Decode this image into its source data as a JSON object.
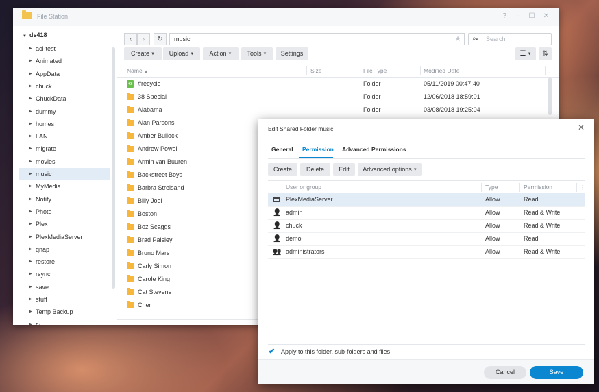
{
  "window": {
    "title": "File Station",
    "controls": [
      "?",
      "–",
      "☐",
      "✕"
    ]
  },
  "tree": {
    "root": "ds418",
    "selected": "music",
    "items": [
      "acl-test",
      "Animated",
      "AppData",
      "chuck",
      "ChuckData",
      "dummy",
      "homes",
      "LAN",
      "migrate",
      "movies",
      "music",
      "MyMedia",
      "Notify",
      "Photo",
      "Plex",
      "PlexMediaServer",
      "qnap",
      "restore",
      "rsync",
      "save",
      "stuff",
      "Temp Backup",
      "tv"
    ]
  },
  "toolbar": {
    "path": "music",
    "search_placeholder": "Search",
    "buttons": [
      "Create",
      "Upload",
      "Action",
      "Tools",
      "Settings"
    ]
  },
  "list": {
    "columns": [
      "Name",
      "Size",
      "File Type",
      "Modified Date"
    ],
    "rows": [
      {
        "name": "#recycle",
        "type": "Folder",
        "date": "05/11/2019 00:47:40",
        "icon": "recycle-icon"
      },
      {
        "name": "38 Special",
        "type": "Folder",
        "date": "12/06/2018 18:59:01",
        "icon": "folder-icon"
      },
      {
        "name": "Alabama",
        "type": "Folder",
        "date": "03/08/2018 19:25:04",
        "icon": "folder-icon"
      },
      {
        "name": "Alan Parsons",
        "type": "",
        "date": "",
        "icon": "folder-icon"
      },
      {
        "name": "Amber Bullock",
        "type": "",
        "date": "",
        "icon": "folder-icon"
      },
      {
        "name": "Andrew Powell",
        "type": "",
        "date": "",
        "icon": "folder-icon"
      },
      {
        "name": "Armin van Buuren",
        "type": "",
        "date": "",
        "icon": "folder-icon"
      },
      {
        "name": "Backstreet Boys",
        "type": "",
        "date": "",
        "icon": "folder-icon"
      },
      {
        "name": "Barbra Streisand",
        "type": "",
        "date": "",
        "icon": "folder-icon"
      },
      {
        "name": "Billy Joel",
        "type": "",
        "date": "",
        "icon": "folder-icon"
      },
      {
        "name": "Boston",
        "type": "",
        "date": "",
        "icon": "folder-icon"
      },
      {
        "name": "Boz Scaggs",
        "type": "",
        "date": "",
        "icon": "folder-icon"
      },
      {
        "name": "Brad Paisley",
        "type": "",
        "date": "",
        "icon": "folder-icon"
      },
      {
        "name": "Bruno Mars",
        "type": "",
        "date": "",
        "icon": "folder-icon"
      },
      {
        "name": "Carly Simon",
        "type": "",
        "date": "",
        "icon": "folder-icon"
      },
      {
        "name": "Carole King",
        "type": "",
        "date": "",
        "icon": "folder-icon"
      },
      {
        "name": "Cat Stevens",
        "type": "",
        "date": "",
        "icon": "folder-icon"
      },
      {
        "name": "Cher",
        "type": "",
        "date": "",
        "icon": "folder-icon"
      }
    ]
  },
  "dialog": {
    "title": "Edit Shared Folder music",
    "tabs": [
      "General",
      "Permission",
      "Advanced Permissions"
    ],
    "active_tab": "Permission",
    "buttons": [
      "Create",
      "Delete",
      "Edit",
      "Advanced options"
    ],
    "columns": [
      "User or group",
      "Type",
      "Permission"
    ],
    "rows": [
      {
        "name": "PlexMediaServer",
        "type": "Allow",
        "perm": "Read",
        "icon": "app-icon"
      },
      {
        "name": "admin",
        "type": "Allow",
        "perm": "Read & Write",
        "icon": "user-icon"
      },
      {
        "name": "chuck",
        "type": "Allow",
        "perm": "Read & Write",
        "icon": "user-icon"
      },
      {
        "name": "demo",
        "type": "Allow",
        "perm": "Read",
        "icon": "user-icon"
      },
      {
        "name": "administrators",
        "type": "Allow",
        "perm": "Read & Write",
        "icon": "group-icon"
      }
    ],
    "apply_label": "Apply to this folder, sub-folders and files",
    "apply_checked": true,
    "cancel_label": "Cancel",
    "save_label": "Save"
  },
  "colors": {
    "accent": "#0b86d0",
    "folder": "#f6b73c",
    "recycle": "#6bbf4c",
    "selection": "#e2ecf7"
  }
}
